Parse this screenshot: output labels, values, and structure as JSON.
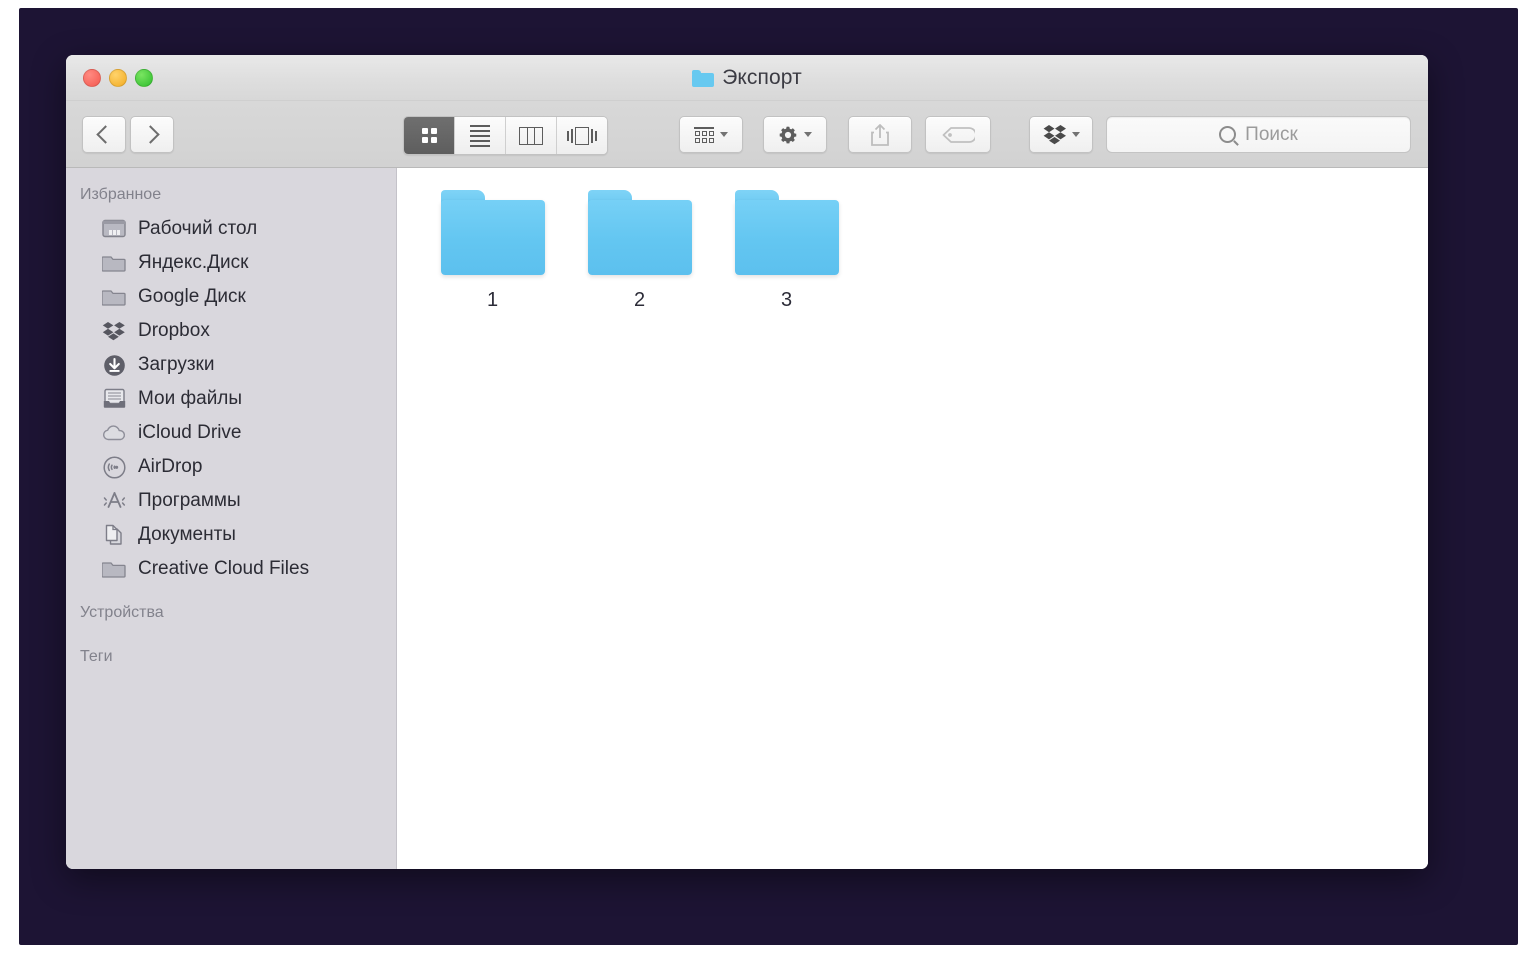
{
  "window": {
    "title": "Экспорт",
    "title_icon": "folder-icon",
    "traffic_lights": [
      {
        "name": "close",
        "color": "#f4594f"
      },
      {
        "name": "minimize",
        "color": "#f2ab22"
      },
      {
        "name": "zoom",
        "color": "#2fbd2d"
      }
    ]
  },
  "toolbar": {
    "back_icon": "chevron-left-icon",
    "forward_icon": "chevron-right-icon",
    "view_modes": [
      {
        "id": "icon",
        "icon": "grid-view-icon",
        "active": true
      },
      {
        "id": "list",
        "icon": "list-view-icon",
        "active": false
      },
      {
        "id": "column",
        "icon": "column-view-icon",
        "active": false
      },
      {
        "id": "coverflow",
        "icon": "coverflow-view-icon",
        "active": false
      }
    ],
    "arrange_icon": "arrange-icon",
    "action_icon": "gear-icon",
    "share_icon": "share-icon",
    "tag_icon": "tag-icon",
    "dropbox_icon": "dropbox-icon",
    "dropdown_caret_icon": "chevron-down-icon"
  },
  "search": {
    "icon": "search-icon",
    "placeholder": "Поиск",
    "value": ""
  },
  "sidebar": {
    "sections": [
      {
        "header": "Избранное",
        "items": [
          {
            "label": "Рабочий стол",
            "icon": "desktop-icon"
          },
          {
            "label": "Яндекс.Диск",
            "icon": "folder-icon"
          },
          {
            "label": "Google Диск",
            "icon": "folder-icon"
          },
          {
            "label": "Dropbox",
            "icon": "dropbox-icon"
          },
          {
            "label": "Загрузки",
            "icon": "downloads-icon"
          },
          {
            "label": "Мои файлы",
            "icon": "all-my-files-icon"
          },
          {
            "label": "iCloud Drive",
            "icon": "cloud-icon"
          },
          {
            "label": "AirDrop",
            "icon": "airdrop-icon"
          },
          {
            "label": "Программы",
            "icon": "applications-icon"
          },
          {
            "label": "Документы",
            "icon": "documents-icon"
          },
          {
            "label": "Creative Cloud Files",
            "icon": "folder-icon"
          }
        ]
      },
      {
        "header": "Устройства",
        "items": []
      },
      {
        "header": "Теги",
        "items": []
      }
    ]
  },
  "content": {
    "files": [
      {
        "name": "1",
        "icon": "folder-icon"
      },
      {
        "name": "2",
        "icon": "folder-icon"
      },
      {
        "name": "3",
        "icon": "folder-icon"
      }
    ]
  },
  "colors": {
    "desktop_background": "#1d1434",
    "folder_blue": "#63c6f1",
    "sidebar_background": "#d9d7dd",
    "toolbar_background": "#d4d4d4",
    "content_background": "#ffffff",
    "active_segment": "#646464"
  }
}
